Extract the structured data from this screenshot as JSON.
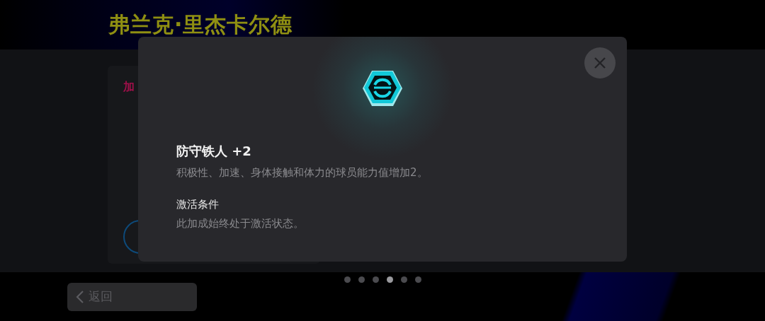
{
  "page": {
    "title": "弗兰克·里杰卡尔德",
    "card": {
      "title": "加"
    }
  },
  "dialog": {
    "title": "防守铁人 +2",
    "description": "积极性、加速、身体接触和体力的球员能力值增加2。",
    "condition_heading": "激活条件",
    "condition_text": "此加成始终处于激活状态。"
  },
  "pagination": [
    {
      "selected": false
    },
    {
      "selected": false
    },
    {
      "selected": false
    },
    {
      "selected": true
    },
    {
      "selected": false
    },
    {
      "selected": false
    }
  ],
  "back_button": {
    "label": "返回"
  }
}
